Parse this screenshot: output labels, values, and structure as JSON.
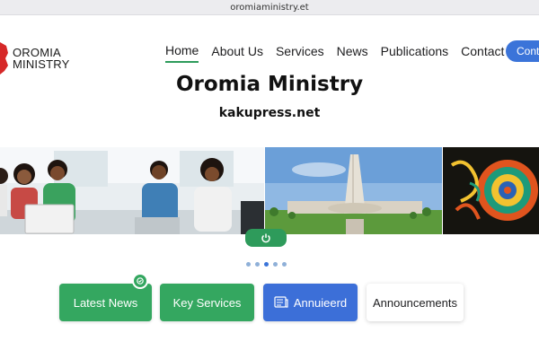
{
  "browser": {
    "url": "oromiaministry.et"
  },
  "logo": {
    "line1": "OROMIA",
    "line2": "MINISTRY"
  },
  "nav": {
    "items": [
      "Home",
      "About Us",
      "Services",
      "News",
      "Publications",
      "Contact"
    ],
    "active": "Home",
    "contact_button": "Contact"
  },
  "hero": {
    "title": "Oromia Ministry",
    "subtitle": "kakupress.net"
  },
  "slider": {
    "slides": [
      "people-at-laptops-photo",
      "monument-building-photo",
      "colorful-pattern-artwork"
    ],
    "button_icon": "power-icon",
    "dots_count": 5,
    "active_dot": 2
  },
  "cards": [
    {
      "label": "Latest News",
      "icon": "check-badge-icon"
    },
    {
      "label": "Key Services"
    },
    {
      "label": "Annuieerd",
      "icon": "newspaper-icon"
    },
    {
      "label": "Announcements"
    }
  ],
  "colors": {
    "primary_green": "#34a760",
    "primary_blue": "#3c6fd8",
    "logo_red": "#d62828"
  }
}
